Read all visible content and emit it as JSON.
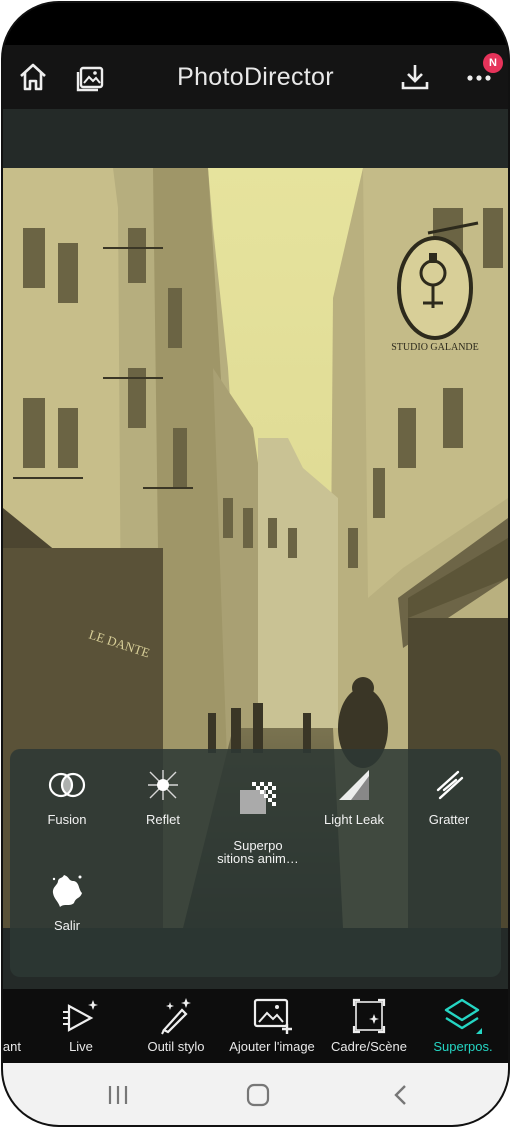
{
  "app": {
    "title": "PhotoDirector",
    "notification_badge": "N"
  },
  "overlay_panel": {
    "items": [
      {
        "label": "Fusion",
        "icon": "fusion-icon"
      },
      {
        "label": "Reflet",
        "icon": "reflet-icon"
      },
      {
        "label": "Superpo\nsitions anim…",
        "icon": "animated-overlay-icon"
      },
      {
        "label": "Light Leak",
        "icon": "light-leak-icon"
      },
      {
        "label": "Gratter",
        "icon": "scratch-icon"
      },
      {
        "label": "Salir",
        "icon": "dirt-icon"
      }
    ]
  },
  "photo": {
    "shop_sign": "STUDIO GALANDE",
    "storefront": "LE DANTE"
  },
  "tabbar": {
    "tabs": [
      {
        "label": "ant",
        "icon": "partial-tab-icon"
      },
      {
        "label": "Live",
        "icon": "live-icon"
      },
      {
        "label": "Outil stylo",
        "icon": "pen-tool-icon"
      },
      {
        "label": "Ajouter l'image",
        "icon": "add-image-icon"
      },
      {
        "label": "Cadre/Scène",
        "icon": "frame-scene-icon"
      },
      {
        "label": "Superpos.",
        "icon": "overlays-icon",
        "active": true
      }
    ],
    "active_color": "#25d5c3"
  },
  "colors": {
    "tint": "#e8e4a0",
    "panel": "#2c3834",
    "accent": "#25d5c3"
  }
}
